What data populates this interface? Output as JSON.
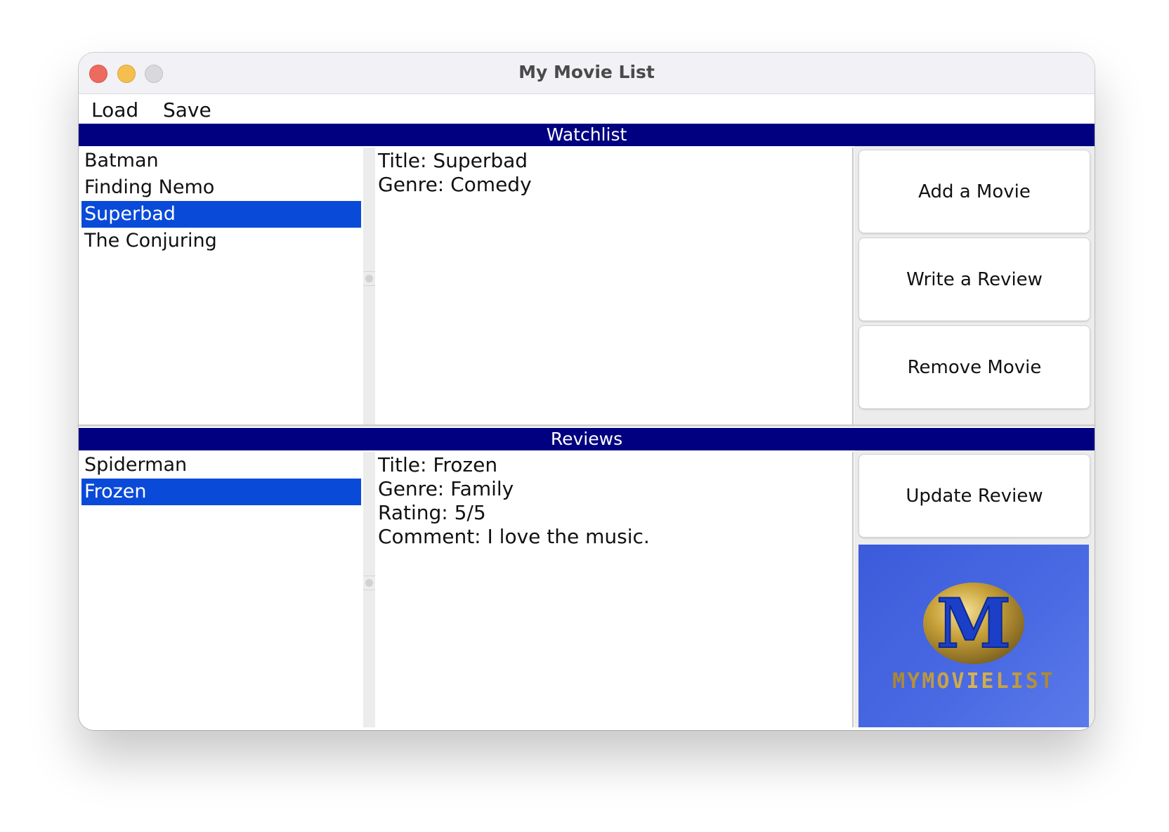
{
  "window": {
    "title": "My Movie List"
  },
  "menu": {
    "load": "Load",
    "save": "Save"
  },
  "watchlist": {
    "header": "Watchlist",
    "items": [
      "Batman",
      "Finding Nemo",
      "Superbad",
      "The Conjuring"
    ],
    "selected_index": 2,
    "detail": [
      "Title: Superbad",
      "Genre: Comedy"
    ],
    "buttons": {
      "add": "Add a Movie",
      "review": "Write a Review",
      "remove": "Remove Movie"
    }
  },
  "reviews": {
    "header": "Reviews",
    "items": [
      "Spiderman",
      "Frozen"
    ],
    "selected_index": 1,
    "detail": [
      "Title: Frozen",
      "Genre: Family",
      "Rating: 5/5",
      "Comment: I love the music."
    ],
    "buttons": {
      "update": "Update Review"
    }
  },
  "logo": {
    "letter": "M",
    "wordmark": "MYMOVIELIST"
  },
  "colors": {
    "header_bg": "#000080",
    "selection": "#0a4ad8",
    "logo_bg": "#4462de",
    "gold": "#c9a23a"
  }
}
